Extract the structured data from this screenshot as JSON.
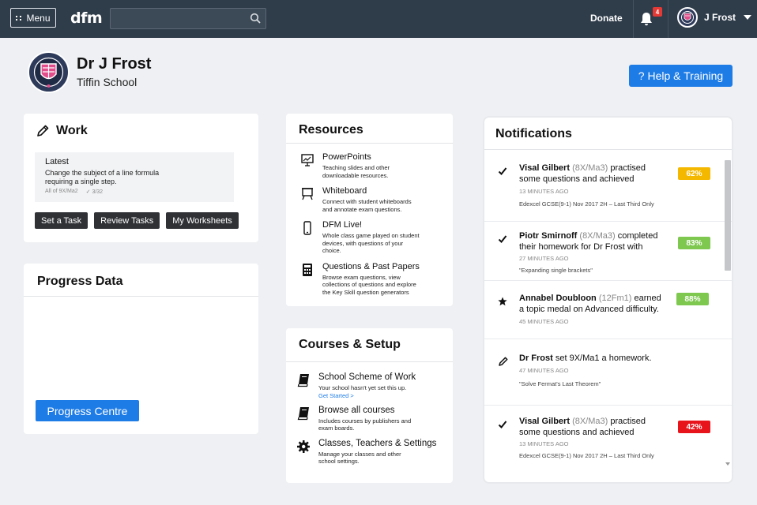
{
  "topbar": {
    "menu_label": "Menu",
    "logo": "dfm",
    "search_placeholder": "",
    "donate_label": "Donate",
    "notification_count": "4",
    "user_name": "J Frost"
  },
  "profile": {
    "name": "Dr J Frost",
    "school": "Tiffin School",
    "help_label": "? Help & Training"
  },
  "work": {
    "title": "Work",
    "latest": {
      "heading": "Latest",
      "description": "Change the subject of a line formula requiring a single step.",
      "class": "All of 9X/Ma2",
      "progress": "3/32"
    },
    "buttons": [
      "Set a Task",
      "Review Tasks",
      "My Worksheets"
    ]
  },
  "progress_data": {
    "title": "Progress Data",
    "button": "Progress Centre"
  },
  "resources": {
    "title": "Resources",
    "items": [
      {
        "title": "PowerPoints",
        "desc": "Teaching slides and other downloadable resources.",
        "icon": "presentation-icon"
      },
      {
        "title": "Whiteboard",
        "desc": "Connect with student whiteboards and annotate exam questions.",
        "icon": "whiteboard-icon"
      },
      {
        "title": "DFM Live!",
        "desc": "Whole class game played on student devices, with questions of your choice.",
        "icon": "phone-icon"
      },
      {
        "title": "Questions & Past Papers",
        "desc": "Browse exam questions, view collections of questions and explore the Key Skill question generators",
        "icon": "calculator-icon"
      }
    ]
  },
  "courses": {
    "title": "Courses & Setup",
    "items": [
      {
        "title": "School Scheme of Work",
        "desc": "Your school hasn't yet set this up.",
        "link": "Get Started >",
        "icon": "book-icon"
      },
      {
        "title": "Browse all courses",
        "desc": "Includes courses by publishers and exam boards.",
        "icon": "book-icon"
      },
      {
        "title": "Classes, Teachers & Settings",
        "desc": "Manage your classes and other school settings.",
        "icon": "gear-icon"
      }
    ]
  },
  "notifications": {
    "title": "Notifications",
    "items": [
      {
        "icon": "check-icon",
        "name": "Visal Gilbert",
        "class": "(8X/Ma3)",
        "text": "practised some questions and achieved",
        "time": "13 MINUTES AGO",
        "sub": "Edexcel GCSE(9-1) Nov 2017 2H – Last Third Only",
        "score": "62%",
        "score_color": "#f5b800"
      },
      {
        "icon": "check-icon",
        "name": "Piotr Smirnoff",
        "class": "(8X/Ma3)",
        "text": "completed their homework for Dr Frost with",
        "time": "27 MINUTES AGO",
        "sub": "\"Expanding single brackets\"",
        "score": "83%",
        "score_color": "#7ec850"
      },
      {
        "icon": "star-icon",
        "name": "Annabel Doubloon",
        "class": "(12Fm1)",
        "text": "earned a topic medal on Advanced difficulty.",
        "time": "45 MINUTES AGO",
        "sub": "",
        "score": "88%",
        "score_color": "#7ec850"
      },
      {
        "icon": "pencil-icon",
        "name": "Dr Frost",
        "class": "",
        "text": "set 9X/Ma1 a homework.",
        "time": "47 MINUTES AGO",
        "sub": "\"Solve Fermat's Last Theorem\"",
        "score": "",
        "score_color": ""
      },
      {
        "icon": "check-icon",
        "name": "Visal Gilbert",
        "class": "(8X/Ma3)",
        "text": "practised some questions and achieved",
        "time": "13 MINUTES AGO",
        "sub": "Edexcel GCSE(9-1) Nov 2017 2H – Last Third Only",
        "score": "42%",
        "score_color": "#e8141c"
      }
    ]
  },
  "colors": {
    "topbar": "#2f3c4a",
    "accent": "#1e7ce6",
    "dark_button": "#2f3135",
    "badge": "#e53935"
  }
}
